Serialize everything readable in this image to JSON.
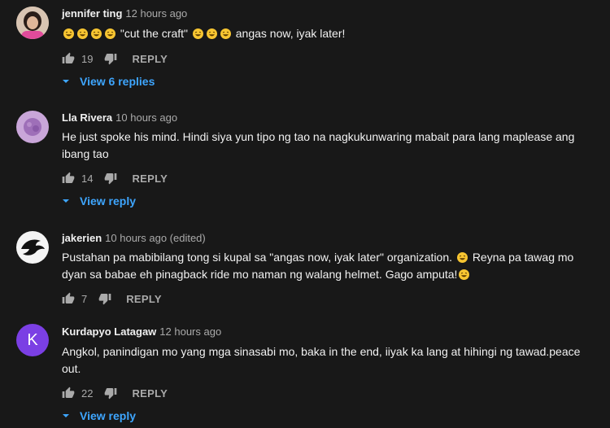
{
  "icons": {
    "like": "thumbs-up-icon",
    "dislike": "thumbs-down-icon",
    "expand": "chevron-down-icon",
    "emoji": "laughing-emoji"
  },
  "colors": {
    "background": "#181818",
    "link": "#3ea6ff",
    "muted": "#aaaaaa",
    "text": "#f1f1f1"
  },
  "comments": [
    {
      "author": "jennifer ting",
      "time": "12 hours ago",
      "text_parts": [
        "\"cut the craft\"",
        "angas now, iyak later!"
      ],
      "likes": "19",
      "reply_label": "REPLY",
      "view_replies": "View 6 replies"
    },
    {
      "author": "Lla Rivera",
      "time": "10 hours ago",
      "text": "He just spoke his mind. Hindi siya yun tipo ng tao na nagkukunwaring mabait para lang maplease ang ibang tao",
      "likes": "14",
      "reply_label": "REPLY",
      "view_replies": "View reply"
    },
    {
      "author": "jakerien",
      "time": "10 hours ago (edited)",
      "text_parts": [
        "Pustahan pa mabibilang tong si kupal sa \"angas now, iyak later\" organization.",
        "Reyna pa tawag mo dyan sa babae eh pinagback ride mo naman ng walang helmet. Gago amputa!"
      ],
      "likes": "7",
      "reply_label": "REPLY"
    },
    {
      "author": "Kurdapyo Latagaw",
      "time": "12 hours ago",
      "avatar_letter": "K",
      "text": "Angkol, panindigan mo yang mga sinasabi mo, baka in the end, iiyak ka lang at hihingi ng tawad.peace out.",
      "likes": "22",
      "reply_label": "REPLY",
      "view_replies": "View reply"
    }
  ]
}
